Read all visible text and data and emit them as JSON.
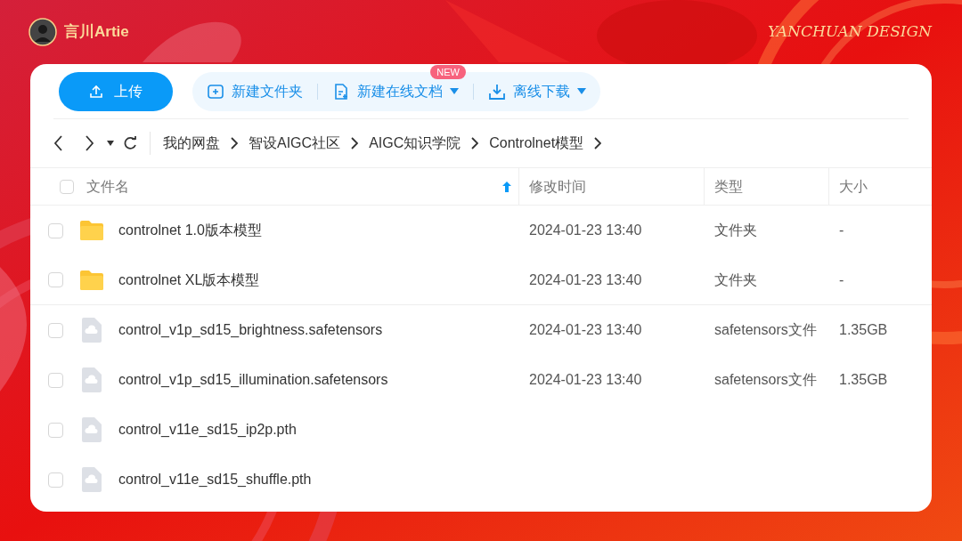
{
  "header": {
    "user": "言川Artie",
    "brand": "YANCHUAN DESIGN"
  },
  "toolbar": {
    "upload": "上传",
    "actions": [
      {
        "kind": "folder",
        "label": "新建文件夹",
        "dropdown": false
      },
      {
        "kind": "doc",
        "label": "新建在线文档",
        "badge": "NEW",
        "dropdown": true
      },
      {
        "kind": "download",
        "label": "离线下载",
        "dropdown": true
      }
    ]
  },
  "breadcrumb": [
    "我的网盘",
    "智设AIGC社区",
    "AIGC知识学院",
    "Controlnet模型"
  ],
  "table": {
    "all_checked": false,
    "columns": [
      {
        "label": "文件名",
        "sorted": true
      },
      {
        "label": "修改时间",
        "sorted": false
      },
      {
        "label": "类型",
        "sorted": false
      },
      {
        "label": "大小",
        "sorted": false
      }
    ],
    "rows": [
      {
        "kind": "folder",
        "checked": false,
        "name": "controlnet 1.0版本模型",
        "modified": "2024-01-23 13:40",
        "type": "文件夹",
        "size": "-"
      },
      {
        "kind": "folder",
        "checked": false,
        "name": "controlnet XL版本模型",
        "modified": "2024-01-23 13:40",
        "type": "文件夹",
        "size": "-"
      },
      {
        "kind": "file",
        "checked": false,
        "name": "control_v1p_sd15_brightness.safetensors",
        "modified": "2024-01-23 13:40",
        "type": "safetensors文件",
        "size": "1.35GB"
      },
      {
        "kind": "file",
        "checked": false,
        "name": "control_v1p_sd15_illumination.safetensors",
        "modified": "2024-01-23 13:40",
        "type": "safetensors文件",
        "size": "1.35GB"
      },
      {
        "kind": "file",
        "checked": false,
        "name": "control_v11e_sd15_ip2p.pth"
      },
      {
        "kind": "file",
        "checked": false,
        "name": "control_v11e_sd15_shuffle.pth"
      }
    ]
  }
}
